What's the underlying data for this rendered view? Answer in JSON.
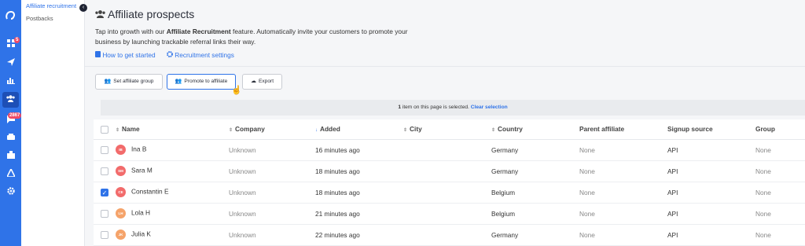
{
  "sidebar": {
    "icons": [
      "logo-icon",
      "dashboard-icon",
      "campaign-icon",
      "reports-icon",
      "affiliates-icon",
      "messages-icon",
      "payouts-icon",
      "integrations-icon",
      "tools-icon",
      "settings-icon"
    ],
    "dashboard_badge": "5",
    "messages_badge": "2867"
  },
  "subnav": {
    "active_label": "Affiliate recruitment",
    "postbacks_label": "Postbacks"
  },
  "header": {
    "title": "Affiliate prospects",
    "desc_before": "Tap into growth with our ",
    "desc_bold": "Affiliate Recruitment",
    "desc_after": " feature. Automatically invite your customers to promote your business by launching trackable referral links their way.",
    "how_to": "How to get started",
    "settings": "Recruitment settings"
  },
  "toolbar": {
    "set_group": "Set affiliate group",
    "promote": "Promote to affiliate",
    "export": "Export"
  },
  "selection": {
    "count": "1",
    "text": " item on this page is selected. ",
    "clear": "Clear selection"
  },
  "table": {
    "headers": {
      "name": "Name",
      "company": "Company",
      "added": "Added",
      "city": "City",
      "country": "Country",
      "parent": "Parent affiliate",
      "source": "Signup source",
      "group": "Group"
    },
    "rows": [
      {
        "initials": "IB",
        "color": "#f26b6b",
        "name": "Ina B",
        "company": "Unknown",
        "added": "16 minutes ago",
        "city": "",
        "country": "Germany",
        "parent": "None",
        "source": "API",
        "group": "None"
      },
      {
        "initials": "SM",
        "color": "#f26b6b",
        "name": "Sara M",
        "company": "Unknown",
        "added": "18 minutes ago",
        "city": "",
        "country": "Germany",
        "parent": "None",
        "source": "API",
        "group": "None"
      },
      {
        "initials": "CE",
        "color": "#f26b6b",
        "name": "Constantin E",
        "company": "Unknown",
        "added": "18 minutes ago",
        "city": "",
        "country": "Belgium",
        "parent": "None",
        "source": "API",
        "group": "None"
      },
      {
        "initials": "LH",
        "color": "#f5a36a",
        "name": "Lola H",
        "company": "Unknown",
        "added": "21 minutes ago",
        "city": "",
        "country": "Belgium",
        "parent": "None",
        "source": "API",
        "group": "None"
      },
      {
        "initials": "JK",
        "color": "#f5a36a",
        "name": "Julia K",
        "company": "Unknown",
        "added": "22 minutes ago",
        "city": "",
        "country": "Germany",
        "parent": "None",
        "source": "API",
        "group": "None"
      }
    ]
  },
  "colors": {
    "accent": "#2f73e8",
    "rail": "#2f73e8"
  }
}
